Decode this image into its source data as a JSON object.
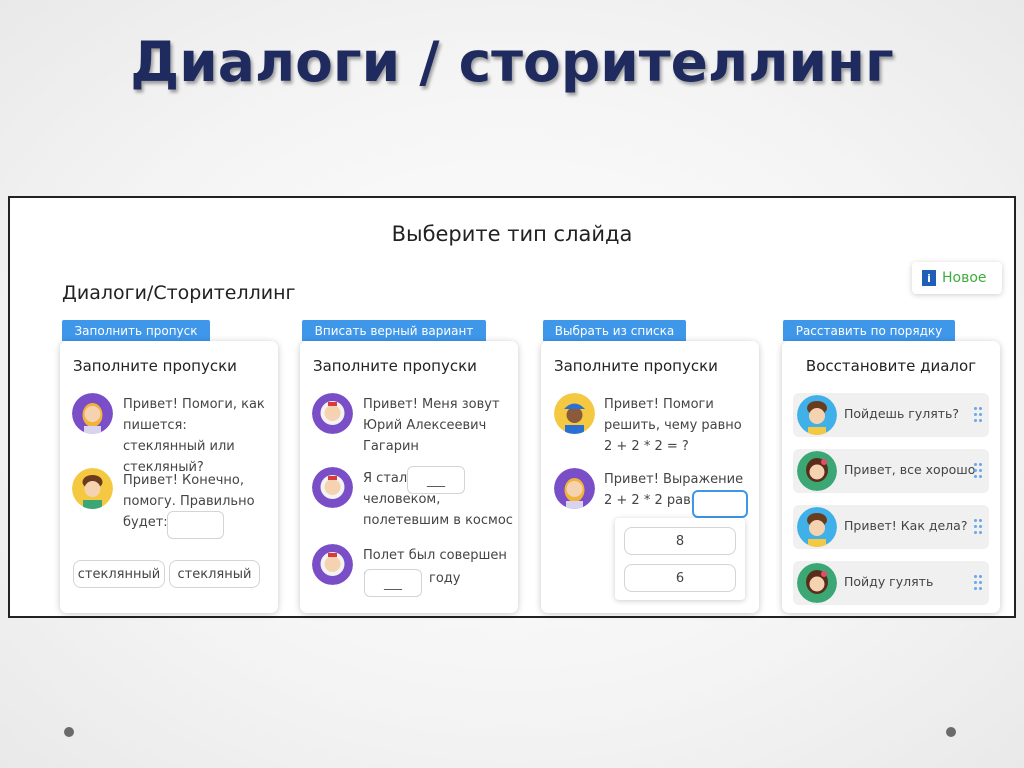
{
  "slide": {
    "title": "Диалоги / сторителлинг"
  },
  "app": {
    "choose_title": "Выберите тип слайда",
    "new_badge": {
      "icon": "i",
      "label": "Новое"
    },
    "section_title": "Диалоги/Сторителлинг"
  },
  "cards": [
    {
      "tab": "Заполнить пропуск",
      "title": "Заполните пропуски",
      "messages": [
        "Привет! Помоги, как пишется: стеклянный или стекляный?",
        "Привет! Конечно, помогу. Правильно будет:"
      ],
      "options": [
        "стеклянный",
        "стекляный"
      ]
    },
    {
      "tab": "Вписать верный вариант",
      "title": "Заполните пропуски",
      "messages": [
        "Привет! Меня зовут Юрий Алексеевич Гагарин",
        "Я стал",
        "человеком, полетевшим в космос",
        "Полет был совершен в",
        "году"
      ],
      "blank": "___"
    },
    {
      "tab": "Выбрать из списка",
      "title": "Заполните пропуски",
      "messages": [
        "Привет! Помоги решить, чему равно 2 + 2 * 2 = ?",
        "Привет! Выражение 2 + 2 * 2 равно"
      ],
      "options": [
        "8",
        "6"
      ]
    },
    {
      "tab": "Расставить по порядку",
      "title": "Восстановите диалог",
      "items": [
        "Пойдешь гулять?",
        "Привет, все хорошо",
        "Привет! Как дела?",
        "Пойду гулять"
      ]
    }
  ],
  "colors": {
    "accent": "#3f97ea",
    "title": "#1f2a5e",
    "new_label": "#3cae3c"
  },
  "icons": [
    "info-icon",
    "drag-handle-icon"
  ]
}
